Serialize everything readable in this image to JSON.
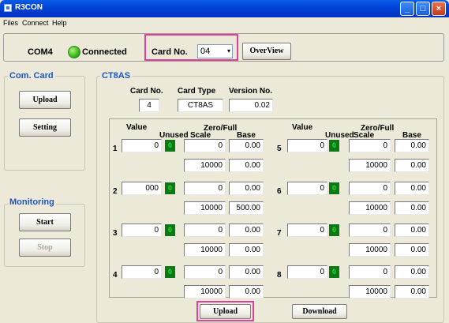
{
  "window": {
    "title": "R3CON",
    "minimize": "_",
    "maximize": "□",
    "close": "×",
    "icon": "app-icon"
  },
  "menu": [
    "Files",
    "Connect",
    "Help"
  ],
  "toolbar": {
    "port": "COM4",
    "status": "Connected",
    "status_color": "#35B51C",
    "card_no_label": "Card No.",
    "card_no_value": "04",
    "overview_button": "OverView",
    "highlight_color": "#E0409C"
  },
  "com_card": {
    "title": "Com. Card",
    "upload": "Upload",
    "setting": "Setting"
  },
  "monitoring": {
    "title": "Monitoring",
    "start": "Start",
    "stop": "Stop"
  },
  "ct8as": {
    "title": "CT8AS",
    "info_headers": [
      "Card No.",
      "Card Type",
      "Version No."
    ],
    "info_values": [
      "4",
      "CT8AS",
      "0.02"
    ],
    "headers": {
      "value": "Value",
      "unused": "Unused",
      "zero_full": "Zero/Full",
      "scale": "Scale",
      "base": "Base"
    },
    "channels": [
      {
        "no": "1",
        "value": "0",
        "unused": "0",
        "zero_scale": "0",
        "zero_base": "0.00",
        "full_scale": "10000",
        "full_base": "0.00"
      },
      {
        "no": "2",
        "value": "000",
        "unused": "0",
        "zero_scale": "0",
        "zero_base": "0.00",
        "full_scale": "10000",
        "full_base": "500.00"
      },
      {
        "no": "3",
        "value": "0",
        "unused": "0",
        "zero_scale": "0",
        "zero_base": "0.00",
        "full_scale": "10000",
        "full_base": "0.00"
      },
      {
        "no": "4",
        "value": "0",
        "unused": "0",
        "zero_scale": "0",
        "zero_base": "0.00",
        "full_scale": "10000",
        "full_base": "0.00"
      },
      {
        "no": "5",
        "value": "0",
        "unused": "0",
        "zero_scale": "0",
        "zero_base": "0.00",
        "full_scale": "10000",
        "full_base": "0.00"
      },
      {
        "no": "6",
        "value": "0",
        "unused": "0",
        "zero_scale": "0",
        "zero_base": "0.00",
        "full_scale": "10000",
        "full_base": "0.00"
      },
      {
        "no": "7",
        "value": "0",
        "unused": "0",
        "zero_scale": "0",
        "zero_base": "0.00",
        "full_scale": "10000",
        "full_base": "0.00"
      },
      {
        "no": "8",
        "value": "0",
        "unused": "0",
        "zero_scale": "0",
        "zero_base": "0.00",
        "full_scale": "10000",
        "full_base": "0.00"
      }
    ],
    "upload": "Upload",
    "download": "Download"
  }
}
